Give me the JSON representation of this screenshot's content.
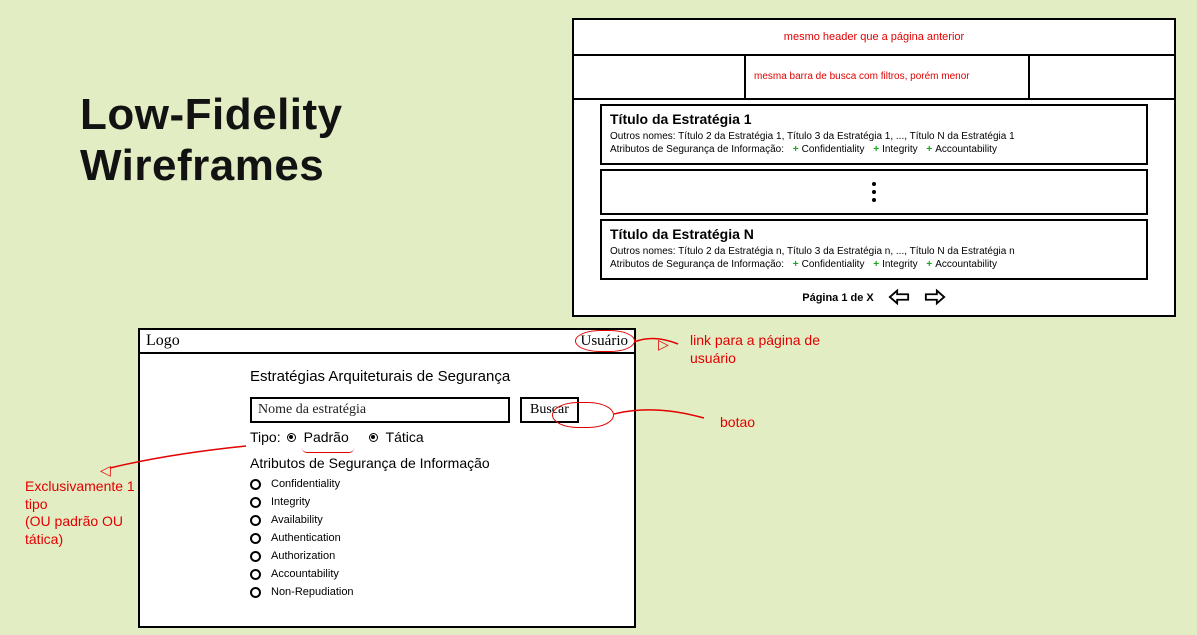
{
  "slide_title_line1": "Low-Fidelity",
  "slide_title_line2": "Wireframes",
  "results": {
    "header_note": "mesmo header que a página anterior",
    "filter_note": "mesma barra de busca com filtros, porém menor",
    "strategy1": {
      "title": "Título da Estratégia 1",
      "other_names": "Outros nomes: Título 2 da Estratégia 1, Título 3 da Estratégia 1, ..., Título N da Estratégia 1",
      "attr_label": "Atributos de Segurança de Informação:",
      "attrs": [
        "Confidentiality",
        "Integrity",
        "Accountability"
      ]
    },
    "strategyN": {
      "title": "Título da Estratégia N",
      "other_names": "Outros nomes: Título 2 da Estratégia n, Título 3 da Estratégia n, ..., Título N da Estratégia n",
      "attr_label": "Atributos de Segurança de Informação:",
      "attrs": [
        "Confidentiality",
        "Integrity",
        "Accountability"
      ]
    },
    "pager_text": "Página 1 de X"
  },
  "search": {
    "logo": "Logo",
    "user": "Usuário",
    "page_title": "Estratégias Arquiteturais de Segurança",
    "input_placeholder": "Nome da estratégia",
    "button_label": "Buscar",
    "type_label": "Tipo:",
    "type_option1": "Padrão",
    "type_option2": "Tática",
    "attributes_title": "Atributos de Segurança de Informação",
    "attributes": [
      "Confidentiality",
      "Integrity",
      "Availability",
      "Authentication",
      "Authorization",
      "Accountability",
      "Non-Repudiation"
    ]
  },
  "annotations": {
    "user_link": "link para a página de usuário",
    "button": "botao",
    "type_exclusive": "Exclusivamente 1 tipo\n(OU padrão OU tática)"
  }
}
